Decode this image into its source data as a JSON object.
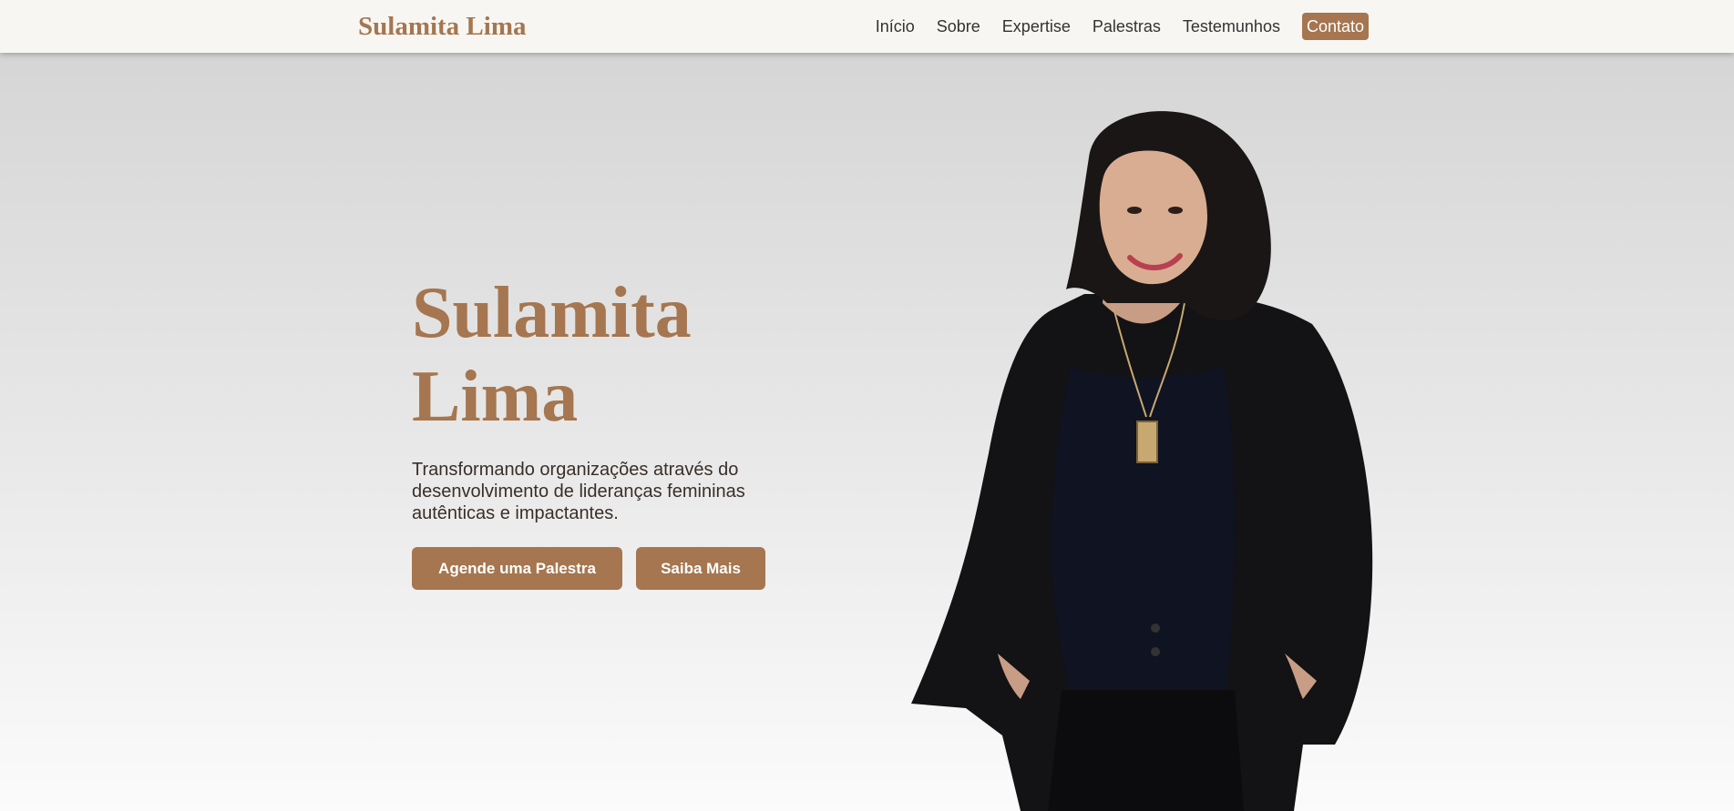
{
  "nav": {
    "brand": "Sulamita Lima",
    "links": [
      {
        "label": "Início"
      },
      {
        "label": "Sobre"
      },
      {
        "label": "Expertise"
      },
      {
        "label": "Palestras"
      },
      {
        "label": "Testemunhos"
      },
      {
        "label": "Contato"
      }
    ]
  },
  "hero": {
    "title_line1": "Sulamita",
    "title_line2": "Lima",
    "subtitle": "Transformando organizações através do desenvolvimento de lideranças femininas autênticas e impactantes.",
    "primary_button": "Agende uma Palestra",
    "secondary_button": "Saiba Mais"
  },
  "colors": {
    "accent": "#a5764f",
    "nav_background": "#f7f6f3",
    "text_dark": "#3a2f28"
  }
}
